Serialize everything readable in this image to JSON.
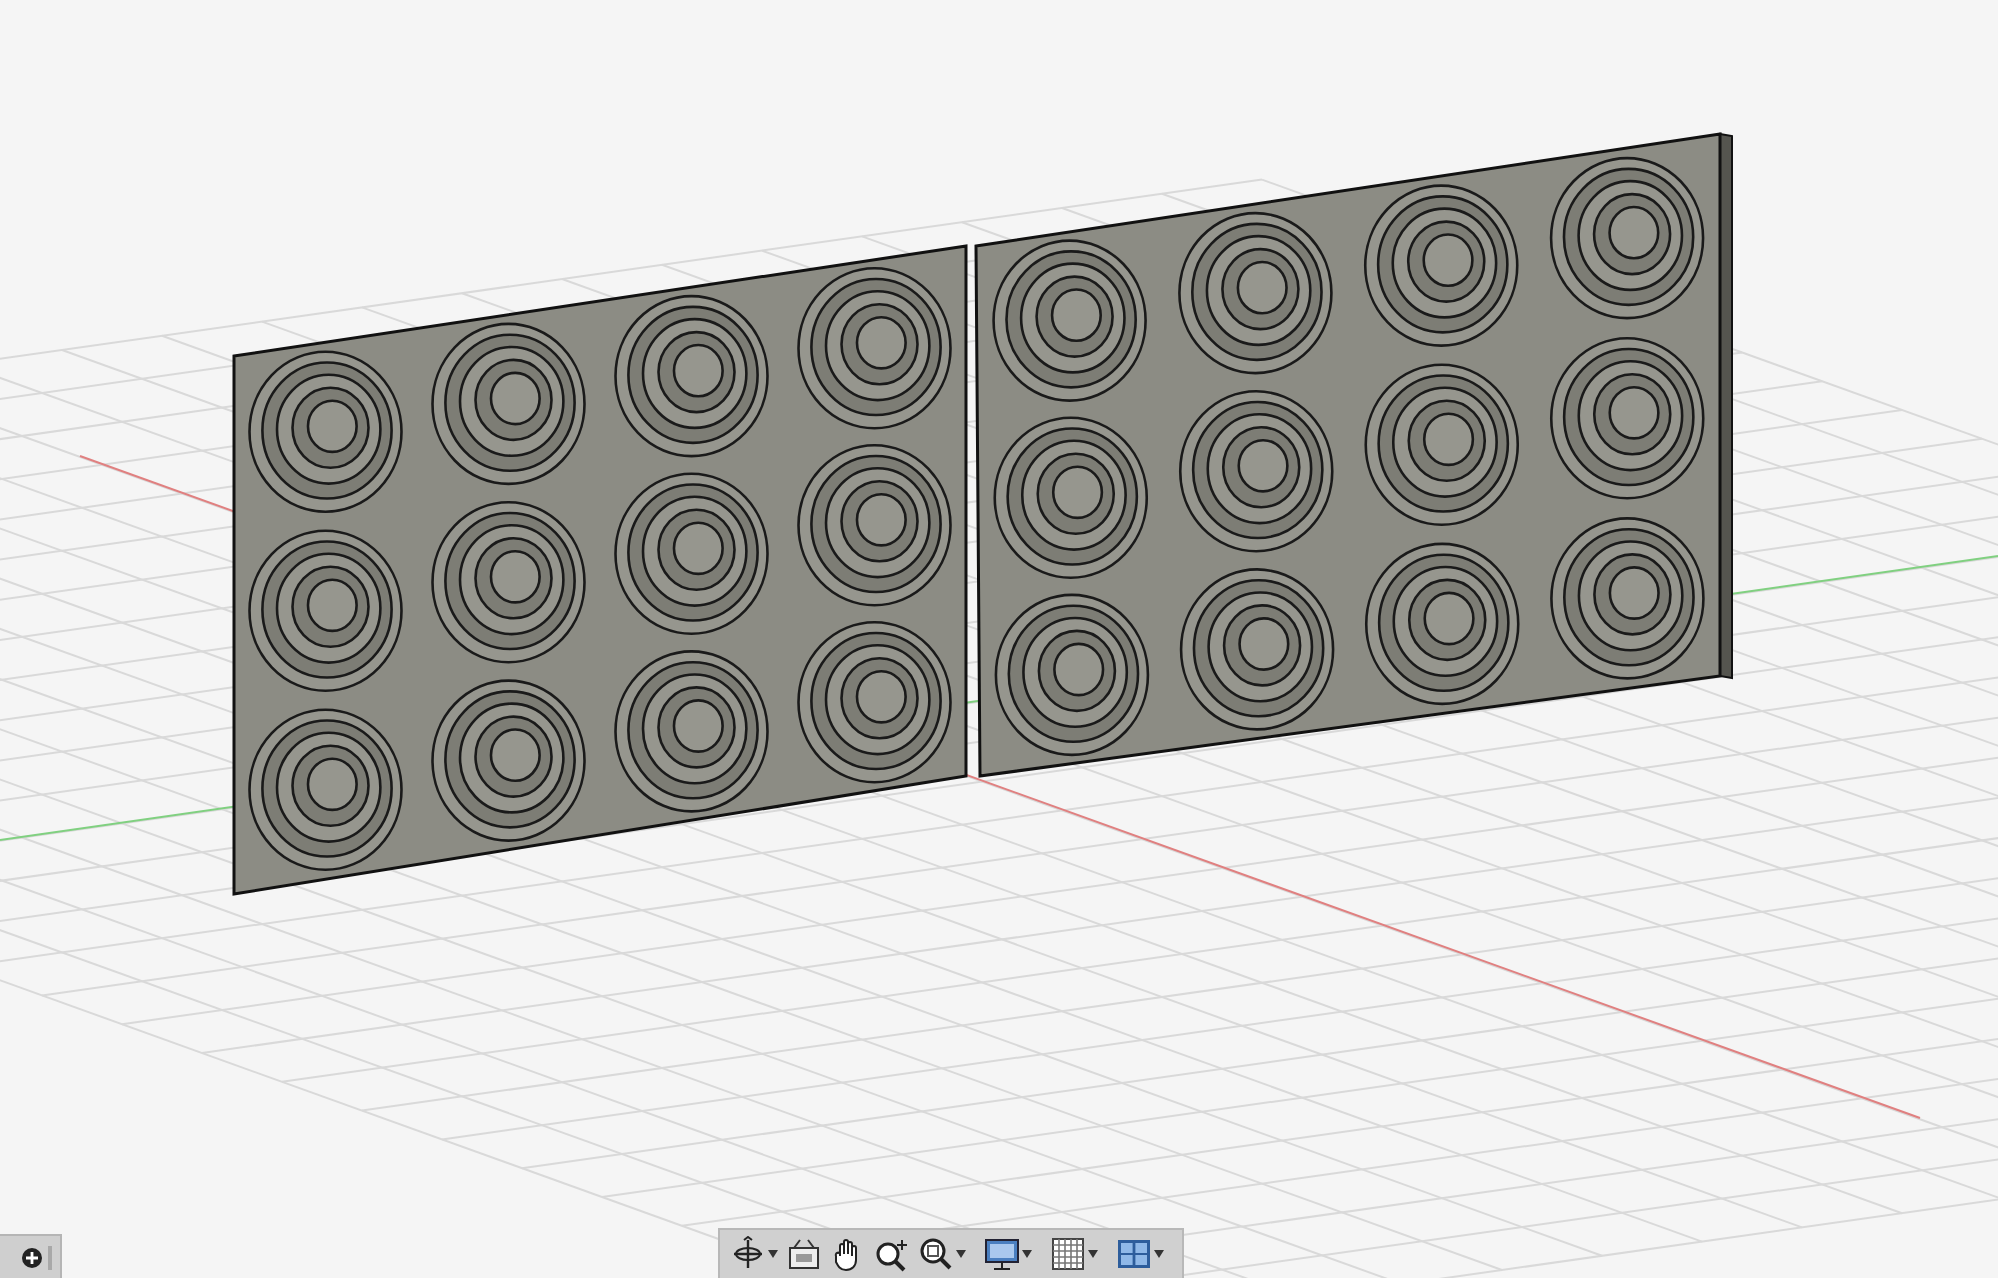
{
  "navigation_toolbar": {
    "groups": [
      {
        "tools": [
          {
            "kind": "orbit",
            "dropdown": true
          },
          {
            "kind": "look-at",
            "dropdown": false
          },
          {
            "kind": "pan",
            "dropdown": false
          },
          {
            "kind": "zoom",
            "dropdown": false
          },
          {
            "kind": "fit",
            "dropdown": true
          }
        ]
      },
      {
        "tools": [
          {
            "kind": "display",
            "dropdown": true
          }
        ]
      },
      {
        "tools": [
          {
            "kind": "grid",
            "dropdown": true
          }
        ]
      },
      {
        "tools": [
          {
            "kind": "viewports",
            "dropdown": true
          }
        ]
      }
    ]
  }
}
